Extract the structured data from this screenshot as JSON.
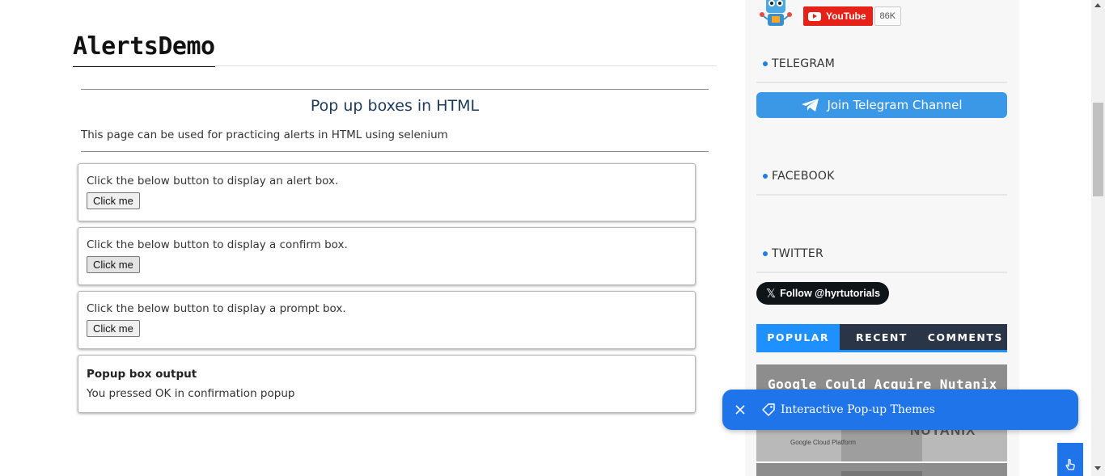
{
  "main": {
    "page_title": "AlertsDemo",
    "heading": "Pop up boxes in HTML",
    "intro": "This page can be used for practicing alerts in HTML using selenium",
    "boxes": [
      {
        "text": "Click the below button to display an alert box.",
        "button": "Click me"
      },
      {
        "text": "Click the below button to display a confirm box.",
        "button": "Click me"
      },
      {
        "text": "Click the below button to display a prompt box.",
        "button": "Click me"
      }
    ],
    "output": {
      "title": "Popup box output",
      "text": "You pressed OK in confirmation popup"
    }
  },
  "sidebar": {
    "youtube": {
      "label": "YouTube",
      "count": "86K"
    },
    "sections": {
      "telegram": "TELEGRAM",
      "facebook": "FACEBOOK",
      "twitter": "TWITTER"
    },
    "telegram_button": "Join Telegram Channel",
    "twitter_button": "Follow @hyrtutorials",
    "tabs": [
      "POPULAR",
      "RECENT",
      "COMMENTS"
    ],
    "active_tab": "POPULAR",
    "post": {
      "title": "Google Could Acquire Nutanix",
      "img_left_text": "Google Cloud Platform",
      "img_right_text": "NUTANIX"
    }
  },
  "toast": {
    "text": "Interactive Pop-up Themes"
  },
  "colors": {
    "accent_blue": "#1e90ff",
    "toast_blue": "#1f74ea",
    "telegram_blue": "#3a98e6",
    "youtube_red": "#e62117",
    "tab_dark": "#2a3548"
  }
}
